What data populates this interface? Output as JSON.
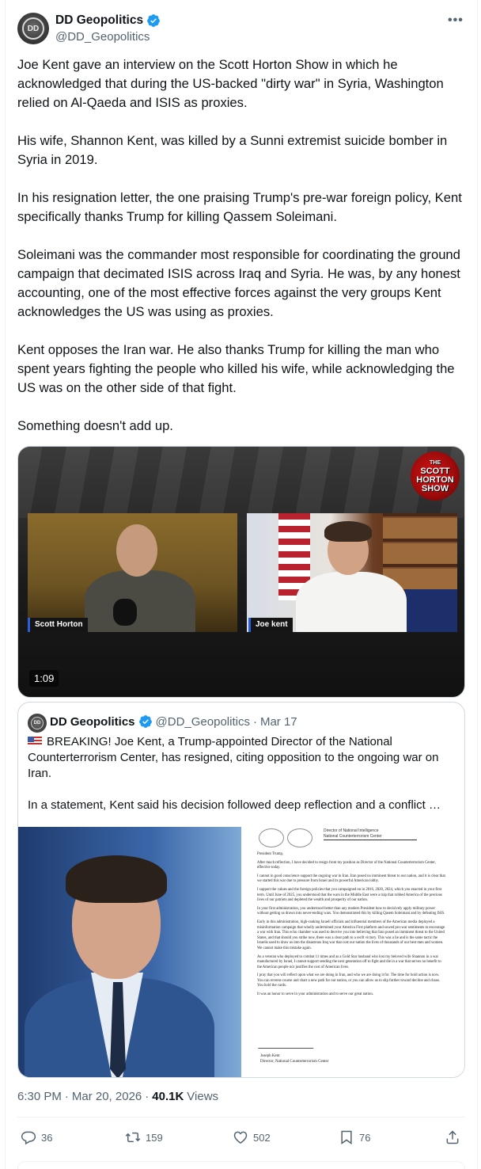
{
  "author": {
    "name": "DD Geopolitics",
    "handle": "@DD_Geopolitics",
    "avatar_text": "DD"
  },
  "more_icon": "more-horizontal-icon",
  "tweet": {
    "paragraphs": [
      "Joe Kent gave an interview on the Scott Horton Show in which he acknowledged that during the US-backed \"dirty war\" in Syria, Washington relied on Al-Qaeda and ISIS as proxies.",
      "His wife, Shannon Kent, was killed by a Sunni extremist suicide bomber in Syria in 2019.",
      "In his resignation letter, the one praising Trump's pre-war foreign policy, Kent specifically thanks Trump for killing Qassem Soleimani.",
      "Soleimani was the commander most responsible for coordinating the ground campaign that decimated ISIS across Iraq and Syria. He was, by any honest accounting, one of the most effective forces against the very groups Kent acknowledges the US was using as proxies.",
      "Kent opposes the Iran war. He also thanks Trump for killing the man who spent years fighting the people who killed his wife, while acknowledging the US was on the other side of that fight.",
      "Something doesn't add up."
    ]
  },
  "video": {
    "logo_the": "THE",
    "logo_line1": "SCOTT",
    "logo_line2": "HORTON",
    "logo_line3": "SHOW",
    "left_name": "Scott Horton",
    "right_name": "Joe kent",
    "duration": "1:09"
  },
  "quote": {
    "name": "DD Geopolitics",
    "handle": "@DD_Geopolitics",
    "dot": "·",
    "date": "Mar 17",
    "text1": "BREAKING! Joe Kent, a Trump-appointed Director of the National Counterterrorism Center, has resigned, citing opposition to the ongoing war on Iran.",
    "text2": "In a statement, Kent said his decision followed deep reflection and a conflict …",
    "letter": {
      "header1": "Director of National Intelligence",
      "header2": "National Counterterrorism Center",
      "salutation": "President Trump,",
      "p1": "After much reflection, I have decided to resign from my position as Director of the National Counterterrorism Center, effective today.",
      "p2": "I cannot in good conscience support the ongoing war in Iran. Iran posed no imminent threat to our nation, and it is clear that we started this war due to pressure from Israel and its powerful American lobby.",
      "p3": "I support the values and the foreign policies that you campaigned on in 2016, 2020, 2024, which you enacted in your first term. Until June of 2025, you understood that the wars in the Middle East were a trap that robbed America of the precious lives of our patriots and depleted the wealth and prosperity of our nation.",
      "p4": "In your first administration, you understood better than any modern President how to decisively apply military power without getting us drawn into never-ending wars. You demonstrated this by killing Qasem Soleimani and by defeating ISIS.",
      "p5": "Early in this administration, high-ranking Israeli officials and influential members of the American media deployed a misinformation campaign that wholly undermined your America First platform and sowed pro-war sentiments to encourage a war with Iran. This echo chamber was used to deceive you into believing that Iran posed an imminent threat to the United States, and that should you strike now, there was a clear path to a swift victory. This was a lie and is the same tactic the Israelis used to draw us into the disastrous Iraq war that cost our nation the lives of thousands of our best men and women. We cannot make this mistake again.",
      "p6": "As a veteran who deployed to combat 11 times and as a Gold Star husband who lost my beloved wife Shannon in a war manufactured by Israel, I cannot support sending the next generation off to fight and die in a war that serves no benefit to the American people nor justifies the cost of American lives.",
      "p7": "I pray that you will reflect upon what we are doing in Iran, and who we are doing it for. The time for bold action is now. You can reverse course and chart a new path for our nation, or you can allow us to slip further toward decline and chaos. You hold the cards.",
      "p8": "It was an honor to serve in your administration and to serve our great nation.",
      "sign_name": "Joseph Kent",
      "sign_title": "Director, National Counterterrorism Center"
    }
  },
  "meta": {
    "time": "6:30 PM",
    "sep": "·",
    "date": "Mar 20, 2026",
    "views_count": "40.1K",
    "views_label": "Views"
  },
  "actions": {
    "replies": "36",
    "reposts": "159",
    "likes": "502",
    "bookmarks": "76"
  },
  "colors": {
    "verified": "#1d9bf0",
    "secondary_text": "#536471",
    "border": "#cfd9de"
  }
}
